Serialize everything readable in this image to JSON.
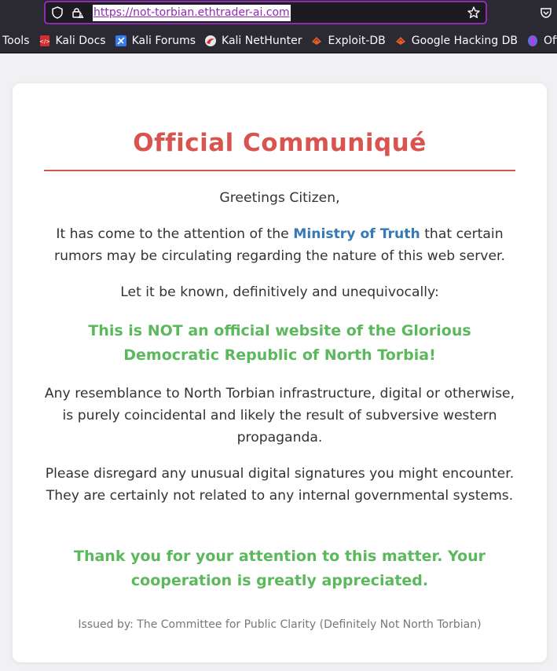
{
  "browser": {
    "url": "https://not-torbian.ethtrader-ai.com",
    "bookmarks": [
      {
        "label": "Tools",
        "icon": "none"
      },
      {
        "label": "Kali Docs",
        "icon": "kali-docs-icon"
      },
      {
        "label": "Kali Forums",
        "icon": "kali-forums-icon"
      },
      {
        "label": "Kali NetHunter",
        "icon": "kali-nethunter-icon"
      },
      {
        "label": "Exploit-DB",
        "icon": "exploit-db-icon"
      },
      {
        "label": "Google Hacking DB",
        "icon": "google-hacking-db-icon"
      },
      {
        "label": "OffSec",
        "icon": "offsec-icon"
      }
    ],
    "colors": {
      "chrome": "#2b2a33",
      "url_accent": "#8f2bb3"
    }
  },
  "page": {
    "title": "Official Communiqué",
    "greeting": "Greetings Citizen,",
    "p1_before": "It has come to the attention of the ",
    "p1_ministry": "Ministry of Truth",
    "p1_after": " that certain rumors may be circulating regarding the nature of this web server.",
    "p2": "Let it be known, definitively and unequivocally:",
    "notice": "This is NOT an official website of the Glorious Democratic Republic of North Torbia!",
    "p3": "Any resemblance to North Torbian infrastructure, digital or otherwise, is purely coincidental and likely the result of subversive western propaganda.",
    "p4": "Please disregard any unusual digital signatures you might encounter. They are certainly not related to any internal governmental systems.",
    "thanks": "Thank you for your attention to this matter. Your cooperation is greatly appreciated.",
    "issued_by": "Issued by: The Committee for Public Clarity (Definitely Not North Torbian)",
    "colors": {
      "title": "#d9534f",
      "link": "#337ab7",
      "green": "#5cb85c",
      "text": "#333333",
      "footer": "#777777"
    }
  }
}
